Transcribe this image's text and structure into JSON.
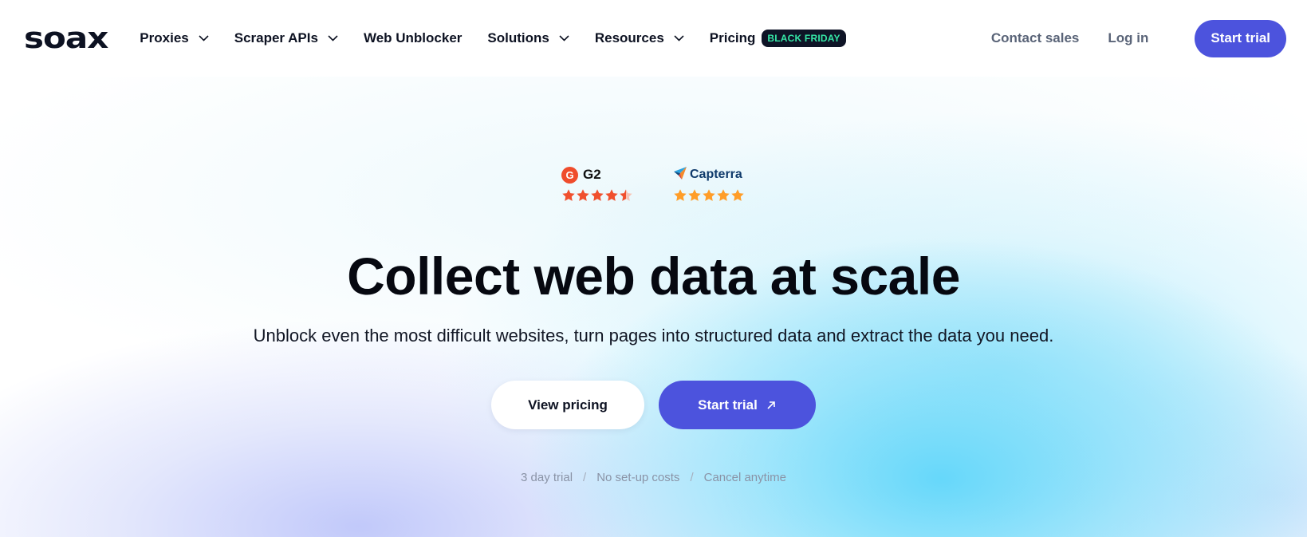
{
  "brand": {
    "logo_text": "soax"
  },
  "nav": {
    "items": [
      {
        "label": "Proxies",
        "has_dropdown": true
      },
      {
        "label": "Scraper APIs",
        "has_dropdown": true
      },
      {
        "label": "Web Unblocker",
        "has_dropdown": false
      },
      {
        "label": "Solutions",
        "has_dropdown": true
      },
      {
        "label": "Resources",
        "has_dropdown": true
      },
      {
        "label": "Pricing",
        "has_dropdown": false,
        "badge": "BLACK FRIDAY"
      }
    ],
    "contact_sales": "Contact sales",
    "log_in": "Log in",
    "start_trial": "Start trial"
  },
  "ratings": [
    {
      "name": "G2",
      "icon": "g2-logo-icon",
      "stars": 4.5,
      "star_color": "#f0502e"
    },
    {
      "name": "Capterra",
      "icon": "capterra-logo-icon",
      "stars": 5,
      "star_color": "#ff9d28"
    }
  ],
  "hero": {
    "title": "Collect web data at scale",
    "subtitle": "Unblock even the most difficult websites, turn pages into structured data and extract the data you need.",
    "secondary_cta": "View pricing",
    "primary_cta": "Start trial",
    "perks": [
      "3 day trial",
      "No set-up costs",
      "Cancel anytime"
    ],
    "perk_separator": "/"
  },
  "colors": {
    "accent": "#4c53dd",
    "badge_bg": "#0e1426",
    "badge_text": "#35e6a6",
    "text_dark": "#0d1222",
    "text_muted": "#5a6478"
  }
}
